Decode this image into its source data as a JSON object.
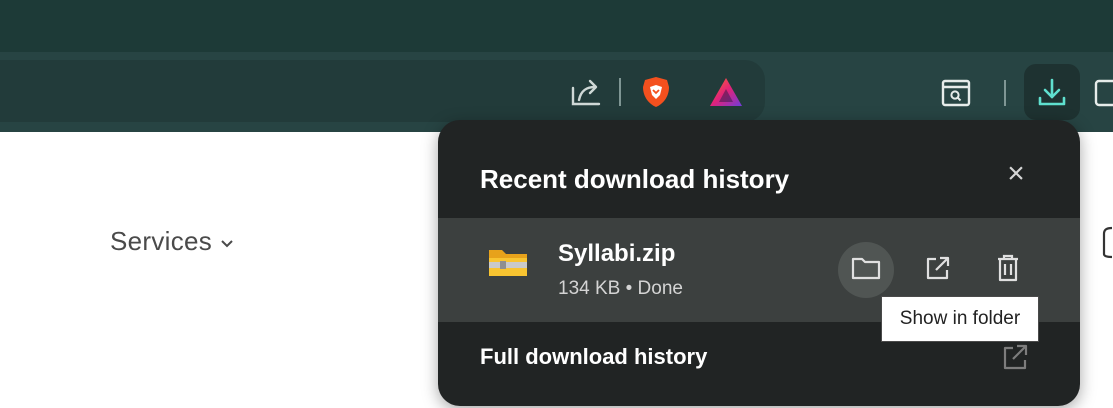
{
  "toolbar": {
    "icons": [
      "share-icon",
      "brave-shields-icon",
      "brave-rewards-icon",
      "reader-mode-icon",
      "downloads-icon",
      "sidebar-icon"
    ]
  },
  "page": {
    "nav_services": "Services"
  },
  "downloads_popup": {
    "title": "Recent download history",
    "close_glyph": "×",
    "items": [
      {
        "name": "Syllabi.zip",
        "meta": "134 KB • Done"
      }
    ],
    "full_history_label": "Full download history"
  },
  "tooltip": {
    "text": "Show in folder"
  },
  "colors": {
    "titlebar": "#1d3a37",
    "toolbar": "#274443",
    "popup_bg": "#212424",
    "item_bg": "#3c403f",
    "brave_orange": "#f4501e"
  }
}
